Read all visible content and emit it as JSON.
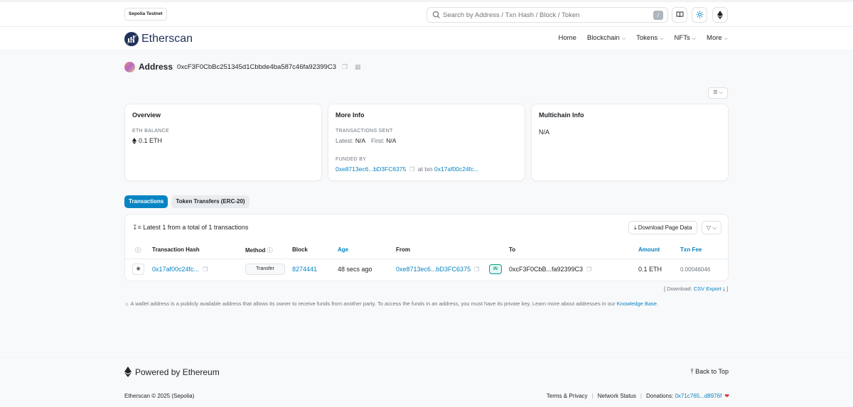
{
  "topbar": {
    "network_badge": "Sepolia Testnet",
    "search_placeholder": "Search by Address / Txn Hash / Block / Token",
    "search_shortcut": "/"
  },
  "navbar": {
    "logo_text": "Etherscan",
    "items": [
      {
        "label": "Home",
        "dropdown": false
      },
      {
        "label": "Blockchain",
        "dropdown": true
      },
      {
        "label": "Tokens",
        "dropdown": true
      },
      {
        "label": "NFTs",
        "dropdown": true
      },
      {
        "label": "More",
        "dropdown": true
      }
    ]
  },
  "address": {
    "label": "Address",
    "hash": "0xcF3F0CbBc251345d1Cbbde4ba587c46fa92399C3"
  },
  "overview": {
    "title": "Overview",
    "eth_balance_label": "ETH BALANCE",
    "eth_balance_value": "0.1 ETH"
  },
  "more_info": {
    "title": "More Info",
    "tx_sent_label": "TRANSACTIONS SENT",
    "latest_label": "Latest:",
    "latest_value": "N/A",
    "first_label": "First:",
    "first_value": "N/A",
    "funded_by_label": "FUNDED BY",
    "funded_by_address": "0xe8713ec6...bD3FC6375",
    "at_txn_label": "at txn",
    "funded_txn": "0x17af00c24fc..."
  },
  "multichain": {
    "title": "Multichain Info",
    "value": "N/A"
  },
  "tabs": [
    {
      "label": "Transactions",
      "active": true
    },
    {
      "label": "Token Transfers (ERC-20)",
      "active": false
    }
  ],
  "transactions": {
    "summary": "Latest 1 from a total of 1 transactions",
    "download_label": "Download Page Data",
    "columns": {
      "hash": "Transaction Hash",
      "method": "Method",
      "block": "Block",
      "age": "Age",
      "from": "From",
      "to": "To",
      "amount": "Amount",
      "fee": "Txn Fee"
    },
    "rows": [
      {
        "hash": "0x17af00c24fc...",
        "method": "Transfer",
        "block": "8274441",
        "age": "48 secs ago",
        "from": "0xe8713ec6...bD3FC6375",
        "direction": "IN",
        "to": "0xcF3F0CbB...fa92399C3",
        "amount": "0.1 ETH",
        "fee": "0.00046046"
      }
    ],
    "csv_prefix": "[ Download:",
    "csv_link": "CSV Export",
    "csv_suffix": "]"
  },
  "note": {
    "text": "A wallet address is a publicly available address that allows its owner to receive funds from another party. To access the funds in an address, you must have its private key. Learn more about addresses in our",
    "link": "Knowledge Base",
    "end": "."
  },
  "footer": {
    "powered": "Powered by Ethereum",
    "back_to_top": "Back to Top",
    "copyright": "Etherscan © 2025 (Sepolia)",
    "terms": "Terms & Privacy",
    "network_status": "Network Status",
    "donations_label": "Donations:",
    "donations_address": "0x71c765...d8976f"
  },
  "colors": {
    "link": "#0784c3",
    "brand": "#21325b",
    "in_badge": "#00a186"
  }
}
